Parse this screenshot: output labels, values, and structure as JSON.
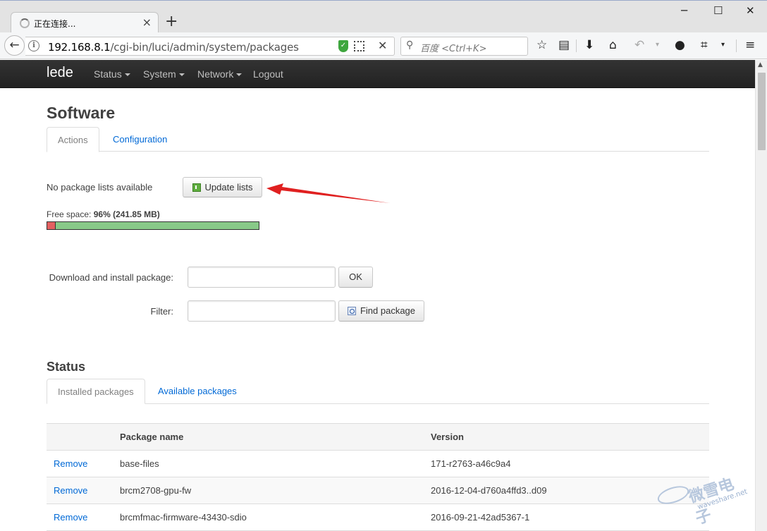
{
  "browser": {
    "tab_title": "正在连接...",
    "tab_close": "×",
    "new_tab": "+",
    "window_controls": [
      "─",
      "☐",
      "✕"
    ],
    "back": "←",
    "info": "i",
    "url_host": "192.168.8.1",
    "url_path": "/cgi-bin/luci/admin/system/packages",
    "url_clear": "✕",
    "search_placeholder": "百度 <Ctrl+K>",
    "toolbar_icons": [
      "star-icon",
      "reading-list-icon",
      "download-icon",
      "home-icon",
      "undo-icon",
      "chat-icon",
      "crop-icon",
      "menu-icon"
    ]
  },
  "navbar": {
    "brand": "lede",
    "items": [
      {
        "label": "Status",
        "dropdown": true
      },
      {
        "label": "System",
        "dropdown": true
      },
      {
        "label": "Network",
        "dropdown": true
      },
      {
        "label": "Logout",
        "dropdown": false
      }
    ]
  },
  "page": {
    "title": "Software",
    "tabs": [
      {
        "label": "Actions",
        "active": true
      },
      {
        "label": "Configuration",
        "active": false
      }
    ],
    "no_lists_text": "No package lists available",
    "update_button": "Update lists",
    "free_space_label": "Free space:",
    "free_space_value": "96% (241.85 MB)",
    "free_fraction": 0.96,
    "download_label": "Download and install package:",
    "download_value": "",
    "ok_button": "OK",
    "filter_label": "Filter:",
    "filter_value": "",
    "find_button": "Find package"
  },
  "status": {
    "title": "Status",
    "tabs": [
      {
        "label": "Installed packages",
        "active": true
      },
      {
        "label": "Available packages",
        "active": false
      }
    ],
    "columns": [
      "",
      "Package name",
      "Version"
    ],
    "rows": [
      {
        "action": "Remove",
        "name": "base-files",
        "version": "171-r2763-a46c9a4"
      },
      {
        "action": "Remove",
        "name": "brcm2708-gpu-fw",
        "version": "2016-12-04-d760a4ffd3..d09"
      },
      {
        "action": "Remove",
        "name": "brcmfmac-firmware-43430-sdio",
        "version": "2016-09-21-42ad5367-1"
      }
    ]
  },
  "watermark": {
    "main": "微雪电子",
    "sub": "waveshare.net"
  },
  "colors": {
    "link": "#0069d6",
    "navbar": "#222222",
    "arrow": "#e02020",
    "bar_used": "#e36060",
    "bar_free": "#88c988"
  }
}
